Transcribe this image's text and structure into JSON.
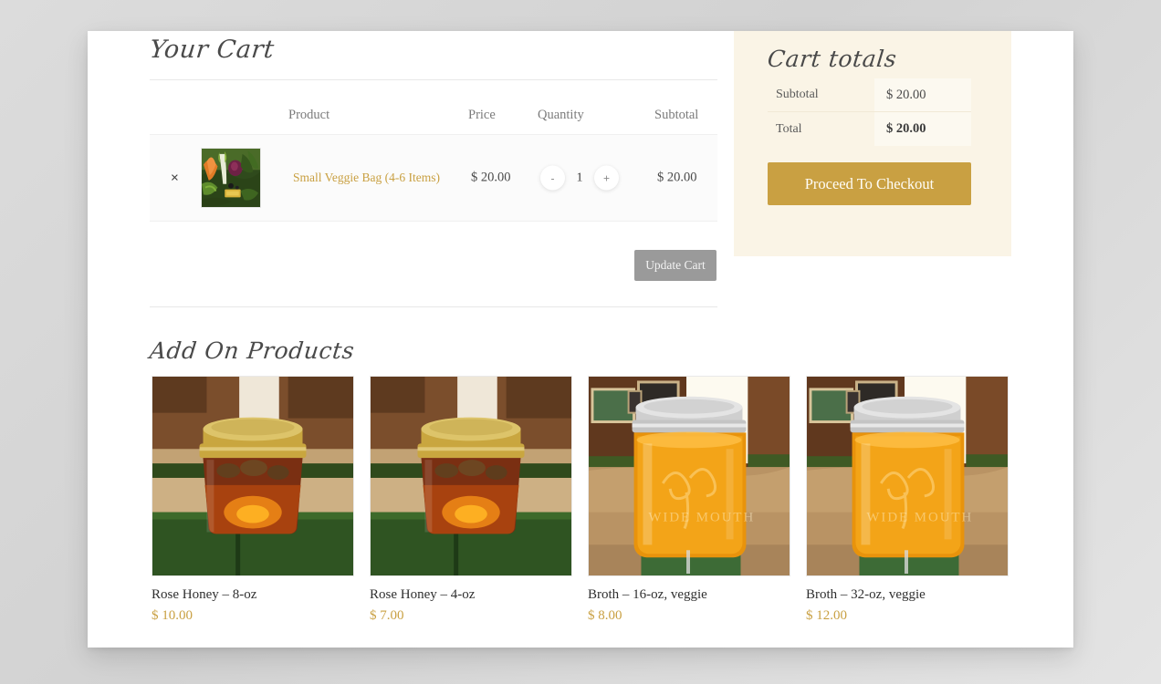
{
  "cart": {
    "heading": "Your Cart",
    "columns": {
      "product": "Product",
      "price": "Price",
      "quantity": "Quantity",
      "subtotal": "Subtotal"
    },
    "remove_glyph": "×",
    "items": [
      {
        "name": "Small Veggie Bag (4-6 Items)",
        "price": "$ 20.00",
        "quantity": "1",
        "subtotal": "$ 20.00",
        "decrement_label": "-",
        "increment_label": "+",
        "image_alt": "veggie-bag-thumbnail"
      }
    ],
    "update_label": "Update Cart"
  },
  "totals": {
    "heading": "Cart totals",
    "rows": [
      {
        "label": "Subtotal",
        "value": "$ 20.00"
      },
      {
        "label": "Total",
        "value": "$ 20.00"
      }
    ],
    "checkout_label": "Proceed To Checkout"
  },
  "addons": {
    "heading": "Add On Products",
    "products": [
      {
        "name": "Rose Honey – 8-oz",
        "price": "$ 10.00",
        "image_alt": "rose-honey-jar-photo"
      },
      {
        "name": "Rose Honey – 4-oz",
        "price": "$ 7.00",
        "image_alt": "rose-honey-jar-photo"
      },
      {
        "name": "Broth – 16-oz, veggie",
        "price": "$ 8.00",
        "image_alt": "veggie-broth-jar-photo"
      },
      {
        "name": "Broth – 32-oz, veggie",
        "price": "$ 12.00",
        "image_alt": "veggie-broth-jar-photo"
      }
    ]
  },
  "colors": {
    "accent_gold": "#c9a042",
    "panel_cream": "#faf4e6",
    "disabled_gray": "#9a9a9a",
    "page_background": "#d5d5d5"
  }
}
